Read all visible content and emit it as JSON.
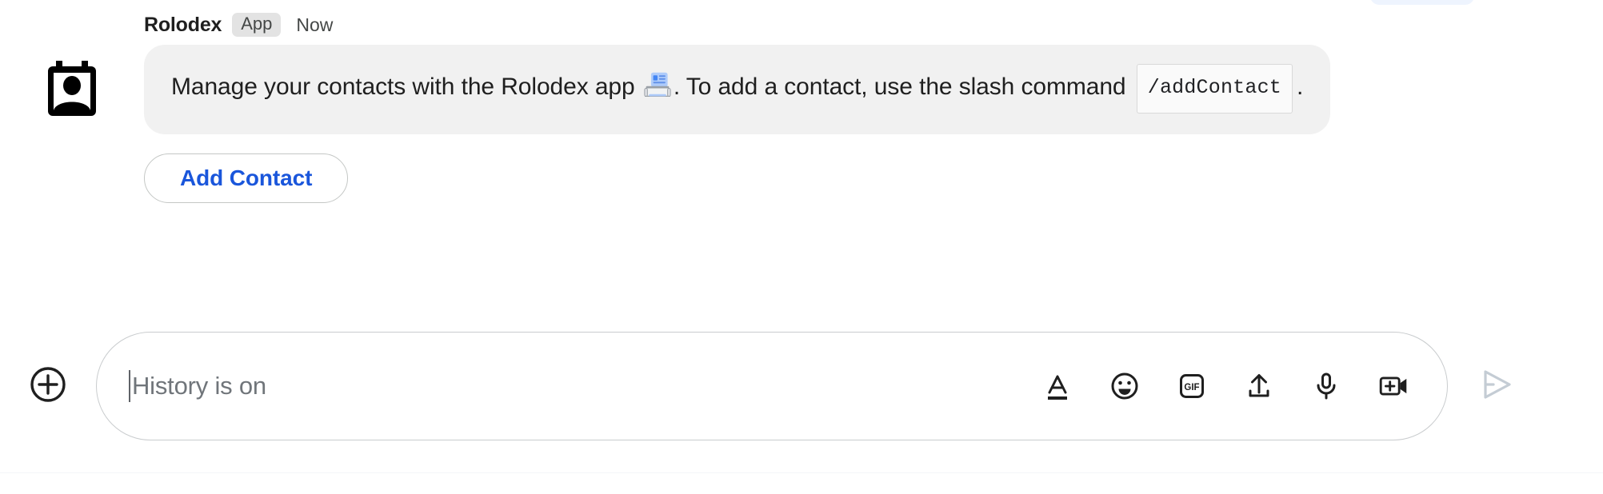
{
  "message": {
    "sender": "Rolodex",
    "badge": "App",
    "timestamp": "Now",
    "avatar_icon": "contact-card-icon",
    "text_before_emoji": "Manage your contacts with the Rolodex app ",
    "inline_emoji": "📇",
    "emoji_name": "card-index-emoji",
    "text_after_emoji": ". To add a contact, use the slash command ",
    "code_chip": "/addContact",
    "text_end": ".",
    "bubble_color": "#f1f1f1"
  },
  "actions": {
    "add_contact_label": "Add Contact",
    "accent_color": "#1a56db"
  },
  "composer": {
    "add_button_icon": "plus-circle-icon",
    "placeholder": "History is on",
    "value": "",
    "tools": [
      {
        "name": "format-text-icon",
        "label": "Format"
      },
      {
        "name": "emoji-icon",
        "label": "Emoji"
      },
      {
        "name": "gif-icon",
        "label": "GIF"
      },
      {
        "name": "upload-icon",
        "label": "Upload file"
      },
      {
        "name": "microphone-icon",
        "label": "Voice message"
      },
      {
        "name": "video-add-icon",
        "label": "Add video meeting"
      }
    ],
    "send_icon": "send-icon",
    "send_enabled": false
  }
}
